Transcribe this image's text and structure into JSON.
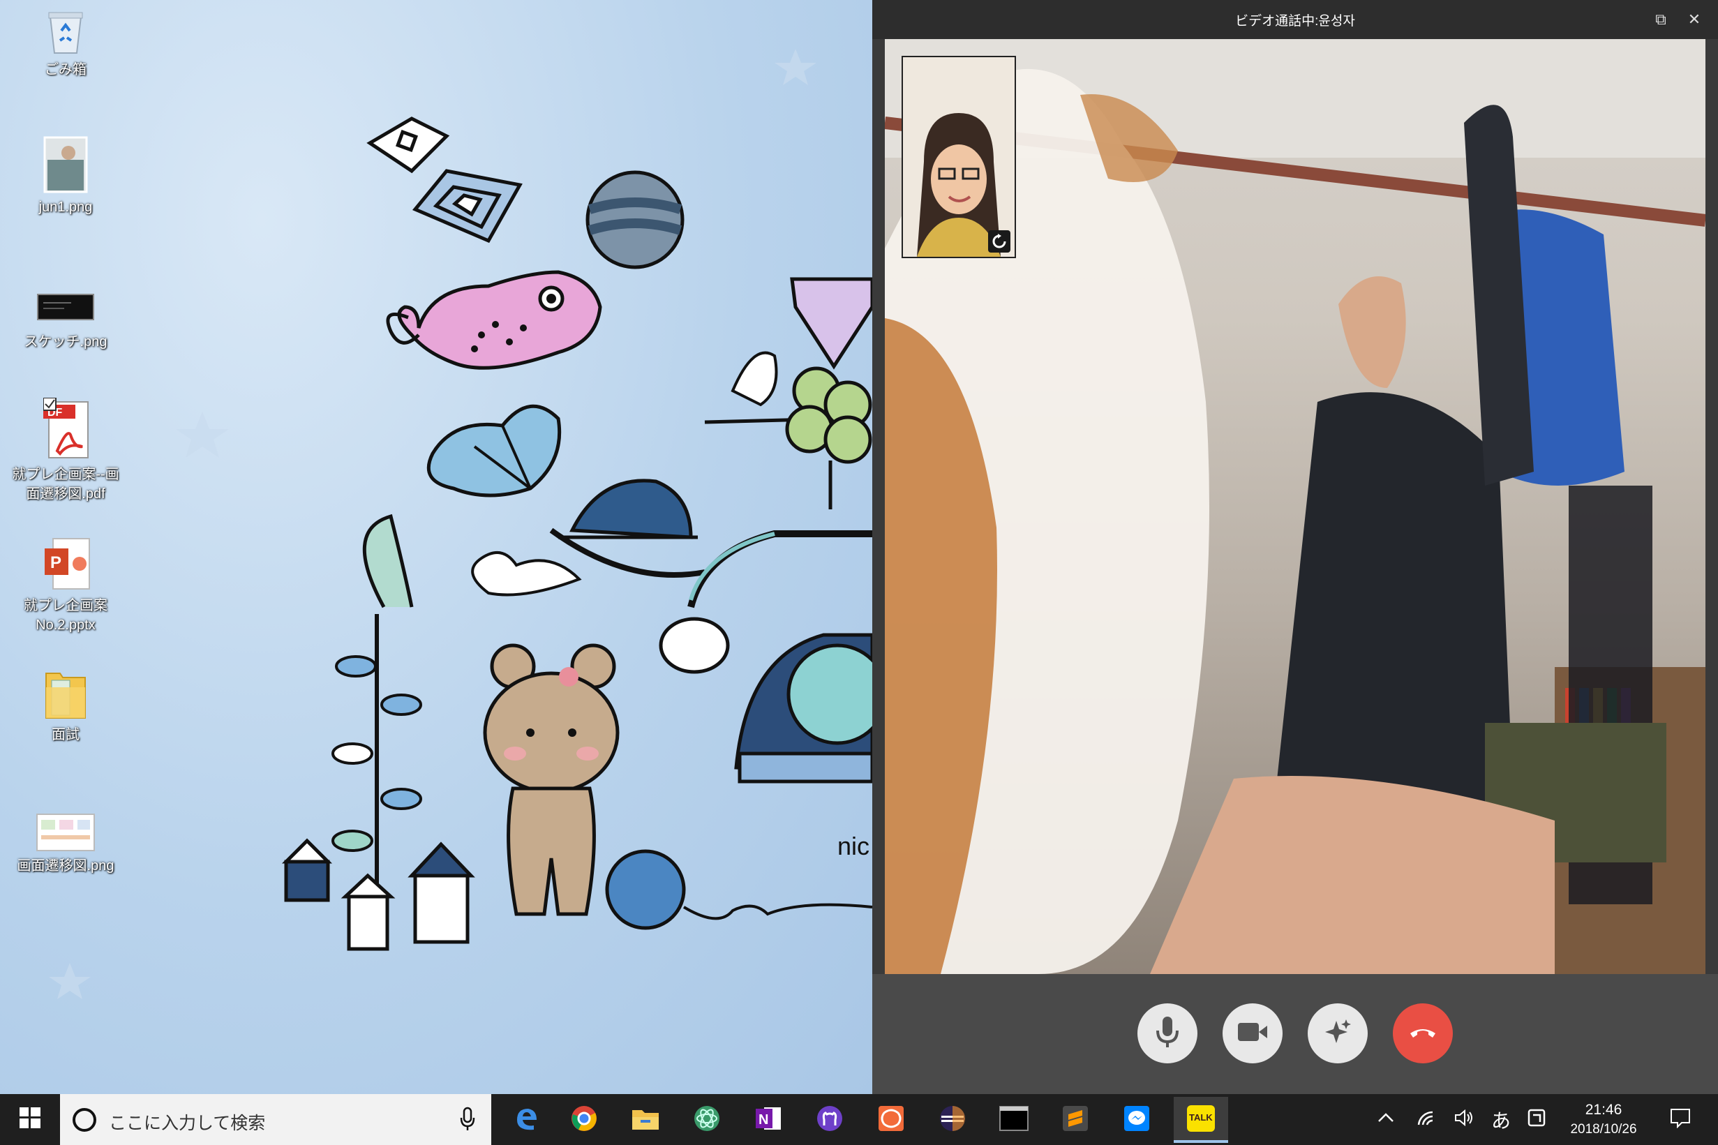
{
  "desktop": {
    "icons": [
      {
        "label": "ごみ箱",
        "icon": "recycle-bin-icon"
      },
      {
        "label": "jun1.png",
        "icon": "image-file-icon"
      },
      {
        "label": "スケッチ.png",
        "icon": "image-file-icon"
      },
      {
        "label": "就プレ企画案--画面遷移図.pdf",
        "icon": "pdf-file-icon"
      },
      {
        "label": "就プレ企画案No.2.pptx",
        "icon": "powerpoint-file-icon"
      },
      {
        "label": "面試",
        "icon": "folder-icon"
      },
      {
        "label": "画面遷移図.png",
        "icon": "image-file-icon"
      }
    ],
    "wallpaper_text": "nic"
  },
  "call": {
    "title": "ビデオ通話中:윤성자",
    "restore": "⧉",
    "close": "✕",
    "controls": [
      "mute-mic",
      "toggle-camera",
      "effects",
      "end-call"
    ],
    "end_color": "#e94f44"
  },
  "taskbar": {
    "search_placeholder": "ここに入力して検索",
    "apps": [
      "edge",
      "chrome",
      "file-explorer",
      "atom",
      "onenote",
      "github",
      "postman",
      "eclipse",
      "terminal",
      "sublime-text",
      "messenger",
      "kakaotalk"
    ],
    "ime": "あ",
    "time": "21:46",
    "date": "2018/10/26",
    "kakaotalk_label": "TALK"
  }
}
